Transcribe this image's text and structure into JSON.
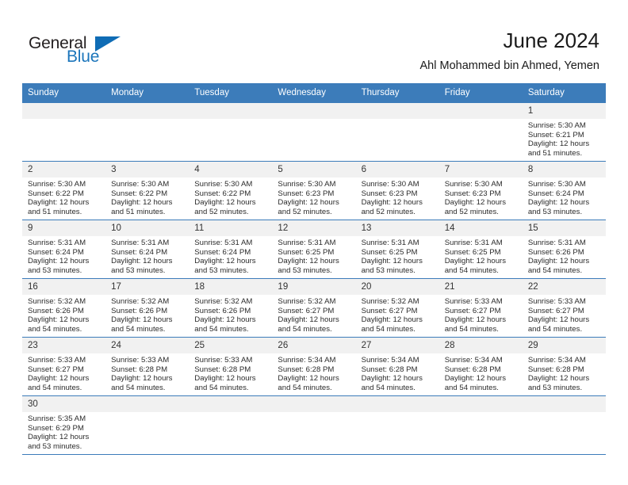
{
  "logo": {
    "part1": "General",
    "part2": "Blue",
    "triangle_color": "#0f6cb5"
  },
  "header": {
    "title": "June 2024",
    "subtitle": "Ahl Mohammed bin Ahmed, Yemen",
    "accent_color": "#3c7cba",
    "daynum_band_color": "#f1f1f1"
  },
  "weekday_headers": [
    "Sunday",
    "Monday",
    "Tuesday",
    "Wednesday",
    "Thursday",
    "Friday",
    "Saturday"
  ],
  "labels": {
    "sunrise_prefix": "Sunrise:",
    "sunset_prefix": "Sunset:",
    "daylight_prefix": "Daylight:"
  },
  "weeks": [
    [
      {
        "day": "",
        "sunrise": "",
        "sunset": "",
        "daylight_line1": "",
        "daylight_line2": ""
      },
      {
        "day": "",
        "sunrise": "",
        "sunset": "",
        "daylight_line1": "",
        "daylight_line2": ""
      },
      {
        "day": "",
        "sunrise": "",
        "sunset": "",
        "daylight_line1": "",
        "daylight_line2": ""
      },
      {
        "day": "",
        "sunrise": "",
        "sunset": "",
        "daylight_line1": "",
        "daylight_line2": ""
      },
      {
        "day": "",
        "sunrise": "",
        "sunset": "",
        "daylight_line1": "",
        "daylight_line2": ""
      },
      {
        "day": "",
        "sunrise": "",
        "sunset": "",
        "daylight_line1": "",
        "daylight_line2": ""
      },
      {
        "day": "1",
        "sunrise": "Sunrise: 5:30 AM",
        "sunset": "Sunset: 6:21 PM",
        "daylight_line1": "Daylight: 12 hours",
        "daylight_line2": "and 51 minutes."
      }
    ],
    [
      {
        "day": "2",
        "sunrise": "Sunrise: 5:30 AM",
        "sunset": "Sunset: 6:22 PM",
        "daylight_line1": "Daylight: 12 hours",
        "daylight_line2": "and 51 minutes."
      },
      {
        "day": "3",
        "sunrise": "Sunrise: 5:30 AM",
        "sunset": "Sunset: 6:22 PM",
        "daylight_line1": "Daylight: 12 hours",
        "daylight_line2": "and 51 minutes."
      },
      {
        "day": "4",
        "sunrise": "Sunrise: 5:30 AM",
        "sunset": "Sunset: 6:22 PM",
        "daylight_line1": "Daylight: 12 hours",
        "daylight_line2": "and 52 minutes."
      },
      {
        "day": "5",
        "sunrise": "Sunrise: 5:30 AM",
        "sunset": "Sunset: 6:23 PM",
        "daylight_line1": "Daylight: 12 hours",
        "daylight_line2": "and 52 minutes."
      },
      {
        "day": "6",
        "sunrise": "Sunrise: 5:30 AM",
        "sunset": "Sunset: 6:23 PM",
        "daylight_line1": "Daylight: 12 hours",
        "daylight_line2": "and 52 minutes."
      },
      {
        "day": "7",
        "sunrise": "Sunrise: 5:30 AM",
        "sunset": "Sunset: 6:23 PM",
        "daylight_line1": "Daylight: 12 hours",
        "daylight_line2": "and 52 minutes."
      },
      {
        "day": "8",
        "sunrise": "Sunrise: 5:30 AM",
        "sunset": "Sunset: 6:24 PM",
        "daylight_line1": "Daylight: 12 hours",
        "daylight_line2": "and 53 minutes."
      }
    ],
    [
      {
        "day": "9",
        "sunrise": "Sunrise: 5:31 AM",
        "sunset": "Sunset: 6:24 PM",
        "daylight_line1": "Daylight: 12 hours",
        "daylight_line2": "and 53 minutes."
      },
      {
        "day": "10",
        "sunrise": "Sunrise: 5:31 AM",
        "sunset": "Sunset: 6:24 PM",
        "daylight_line1": "Daylight: 12 hours",
        "daylight_line2": "and 53 minutes."
      },
      {
        "day": "11",
        "sunrise": "Sunrise: 5:31 AM",
        "sunset": "Sunset: 6:24 PM",
        "daylight_line1": "Daylight: 12 hours",
        "daylight_line2": "and 53 minutes."
      },
      {
        "day": "12",
        "sunrise": "Sunrise: 5:31 AM",
        "sunset": "Sunset: 6:25 PM",
        "daylight_line1": "Daylight: 12 hours",
        "daylight_line2": "and 53 minutes."
      },
      {
        "day": "13",
        "sunrise": "Sunrise: 5:31 AM",
        "sunset": "Sunset: 6:25 PM",
        "daylight_line1": "Daylight: 12 hours",
        "daylight_line2": "and 53 minutes."
      },
      {
        "day": "14",
        "sunrise": "Sunrise: 5:31 AM",
        "sunset": "Sunset: 6:25 PM",
        "daylight_line1": "Daylight: 12 hours",
        "daylight_line2": "and 54 minutes."
      },
      {
        "day": "15",
        "sunrise": "Sunrise: 5:31 AM",
        "sunset": "Sunset: 6:26 PM",
        "daylight_line1": "Daylight: 12 hours",
        "daylight_line2": "and 54 minutes."
      }
    ],
    [
      {
        "day": "16",
        "sunrise": "Sunrise: 5:32 AM",
        "sunset": "Sunset: 6:26 PM",
        "daylight_line1": "Daylight: 12 hours",
        "daylight_line2": "and 54 minutes."
      },
      {
        "day": "17",
        "sunrise": "Sunrise: 5:32 AM",
        "sunset": "Sunset: 6:26 PM",
        "daylight_line1": "Daylight: 12 hours",
        "daylight_line2": "and 54 minutes."
      },
      {
        "day": "18",
        "sunrise": "Sunrise: 5:32 AM",
        "sunset": "Sunset: 6:26 PM",
        "daylight_line1": "Daylight: 12 hours",
        "daylight_line2": "and 54 minutes."
      },
      {
        "day": "19",
        "sunrise": "Sunrise: 5:32 AM",
        "sunset": "Sunset: 6:27 PM",
        "daylight_line1": "Daylight: 12 hours",
        "daylight_line2": "and 54 minutes."
      },
      {
        "day": "20",
        "sunrise": "Sunrise: 5:32 AM",
        "sunset": "Sunset: 6:27 PM",
        "daylight_line1": "Daylight: 12 hours",
        "daylight_line2": "and 54 minutes."
      },
      {
        "day": "21",
        "sunrise": "Sunrise: 5:33 AM",
        "sunset": "Sunset: 6:27 PM",
        "daylight_line1": "Daylight: 12 hours",
        "daylight_line2": "and 54 minutes."
      },
      {
        "day": "22",
        "sunrise": "Sunrise: 5:33 AM",
        "sunset": "Sunset: 6:27 PM",
        "daylight_line1": "Daylight: 12 hours",
        "daylight_line2": "and 54 minutes."
      }
    ],
    [
      {
        "day": "23",
        "sunrise": "Sunrise: 5:33 AM",
        "sunset": "Sunset: 6:27 PM",
        "daylight_line1": "Daylight: 12 hours",
        "daylight_line2": "and 54 minutes."
      },
      {
        "day": "24",
        "sunrise": "Sunrise: 5:33 AM",
        "sunset": "Sunset: 6:28 PM",
        "daylight_line1": "Daylight: 12 hours",
        "daylight_line2": "and 54 minutes."
      },
      {
        "day": "25",
        "sunrise": "Sunrise: 5:33 AM",
        "sunset": "Sunset: 6:28 PM",
        "daylight_line1": "Daylight: 12 hours",
        "daylight_line2": "and 54 minutes."
      },
      {
        "day": "26",
        "sunrise": "Sunrise: 5:34 AM",
        "sunset": "Sunset: 6:28 PM",
        "daylight_line1": "Daylight: 12 hours",
        "daylight_line2": "and 54 minutes."
      },
      {
        "day": "27",
        "sunrise": "Sunrise: 5:34 AM",
        "sunset": "Sunset: 6:28 PM",
        "daylight_line1": "Daylight: 12 hours",
        "daylight_line2": "and 54 minutes."
      },
      {
        "day": "28",
        "sunrise": "Sunrise: 5:34 AM",
        "sunset": "Sunset: 6:28 PM",
        "daylight_line1": "Daylight: 12 hours",
        "daylight_line2": "and 54 minutes."
      },
      {
        "day": "29",
        "sunrise": "Sunrise: 5:34 AM",
        "sunset": "Sunset: 6:28 PM",
        "daylight_line1": "Daylight: 12 hours",
        "daylight_line2": "and 53 minutes."
      }
    ],
    [
      {
        "day": "30",
        "sunrise": "Sunrise: 5:35 AM",
        "sunset": "Sunset: 6:29 PM",
        "daylight_line1": "Daylight: 12 hours",
        "daylight_line2": "and 53 minutes."
      },
      {
        "day": "",
        "sunrise": "",
        "sunset": "",
        "daylight_line1": "",
        "daylight_line2": ""
      },
      {
        "day": "",
        "sunrise": "",
        "sunset": "",
        "daylight_line1": "",
        "daylight_line2": ""
      },
      {
        "day": "",
        "sunrise": "",
        "sunset": "",
        "daylight_line1": "",
        "daylight_line2": ""
      },
      {
        "day": "",
        "sunrise": "",
        "sunset": "",
        "daylight_line1": "",
        "daylight_line2": ""
      },
      {
        "day": "",
        "sunrise": "",
        "sunset": "",
        "daylight_line1": "",
        "daylight_line2": ""
      },
      {
        "day": "",
        "sunrise": "",
        "sunset": "",
        "daylight_line1": "",
        "daylight_line2": ""
      }
    ]
  ]
}
